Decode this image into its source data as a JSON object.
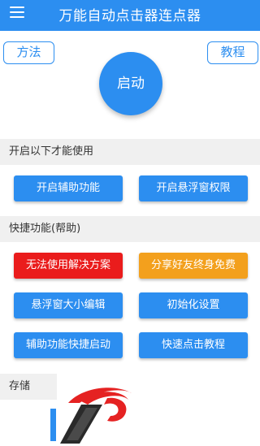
{
  "header": {
    "title": "万能自动点击器连点器",
    "menu_icon": "hamburger-menu-icon"
  },
  "top_buttons": {
    "method": "方法",
    "tutorial": "教程"
  },
  "start_button": "启动",
  "sections": {
    "prerequisites": "开启以下才能使用",
    "shortcuts": "快捷功能(帮助)",
    "storage": "存储"
  },
  "buttons": {
    "enable_accessibility": "开启辅助功能",
    "enable_overlay_permission": "开启悬浮窗权限",
    "cannot_use_solution": "无法使用解决方案",
    "share_lifetime_free": "分享好友终身免费",
    "overlay_size_edit": "悬浮窗大小编辑",
    "initialize_settings": "初始化设置",
    "accessibility_quick_start": "辅助功能快捷启动",
    "quick_click_tutorial": "快速点击教程"
  },
  "colors": {
    "primary": "#2c8ef0",
    "danger": "#ea1c1c",
    "warning": "#f3a01d",
    "section_bg": "#f0f0f0"
  }
}
